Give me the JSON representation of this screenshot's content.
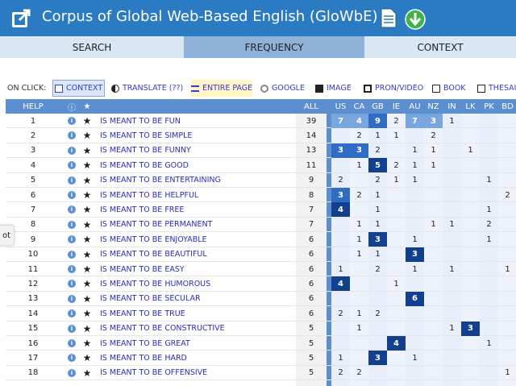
{
  "header": {
    "title": "Corpus of Global Web-Based English (GloWbE)"
  },
  "tabs": [
    {
      "label": "SEARCH",
      "active": false
    },
    {
      "label": "FREQUENCY",
      "active": true
    },
    {
      "label": "CONTEXT",
      "active": false
    }
  ],
  "onclick": {
    "label": "ON CLICK:",
    "options": [
      "CONTEXT",
      "TRANSLATE  (??)",
      "ENTIRE PAGE",
      "GOOGLE",
      "IMAGE",
      "PRON/VIDEO",
      "BOOK",
      "THESAURUS"
    ]
  },
  "side_tab": "ot",
  "table": {
    "headers": {
      "help": "HELP",
      "info": "ⓘ",
      "star": "★",
      "all": "ALL"
    },
    "countries": [
      "US",
      "CA",
      "GB",
      "IE",
      "AU",
      "NZ",
      "IN",
      "LK",
      "PK",
      "BD"
    ],
    "rows": [
      {
        "n": "1",
        "word": "IS MEANT TO BE FUN",
        "all": "39",
        "vals": [
          "7",
          "4",
          "9",
          "2",
          "7",
          "3",
          "1",
          "",
          "",
          ""
        ]
      },
      {
        "n": "2",
        "word": "IS MEANT TO BE SIMPLE",
        "all": "14",
        "vals": [
          "",
          "2",
          "1",
          "1",
          "",
          "2",
          "",
          "",
          "",
          ""
        ]
      },
      {
        "n": "3",
        "word": "IS MEANT TO BE FUNNY",
        "all": "13",
        "vals": [
          "3",
          "3",
          "2",
          "",
          "1",
          "1",
          "",
          "1",
          "",
          ""
        ]
      },
      {
        "n": "4",
        "word": "IS MEANT TO BE GOOD",
        "all": "11",
        "vals": [
          "",
          "1",
          "5",
          "2",
          "1",
          "1",
          "",
          "",
          "",
          ""
        ]
      },
      {
        "n": "5",
        "word": "IS MEANT TO BE ENTERTAINING",
        "all": "9",
        "vals": [
          "2",
          "",
          "2",
          "1",
          "1",
          "",
          "",
          "",
          "1",
          ""
        ]
      },
      {
        "n": "6",
        "word": "IS MEANT TO BE HELPFUL",
        "all": "8",
        "vals": [
          "3",
          "2",
          "1",
          "",
          "",
          "",
          "",
          "",
          "",
          "2"
        ]
      },
      {
        "n": "7",
        "word": "IS MEANT TO BE FREE",
        "all": "7",
        "vals": [
          "4",
          "",
          "1",
          "",
          "",
          "",
          "",
          "",
          "1",
          ""
        ]
      },
      {
        "n": "8",
        "word": "IS MEANT TO BE PERMANENT",
        "all": "7",
        "vals": [
          "",
          "1",
          "1",
          "",
          "",
          "1",
          "1",
          "",
          "2",
          ""
        ]
      },
      {
        "n": "9",
        "word": "IS MEANT TO BE ENJOYABLE",
        "all": "6",
        "vals": [
          "",
          "1",
          "3",
          "",
          "1",
          "",
          "",
          "",
          "1",
          ""
        ]
      },
      {
        "n": "10",
        "word": "IS MEANT TO BE BEAUTIFUL",
        "all": "6",
        "vals": [
          "",
          "1",
          "1",
          "",
          "3",
          "",
          "",
          "",
          "",
          ""
        ]
      },
      {
        "n": "11",
        "word": "IS MEANT TO BE EASY",
        "all": "6",
        "vals": [
          "1",
          "",
          "2",
          "",
          "1",
          "",
          "1",
          "",
          "",
          "1"
        ]
      },
      {
        "n": "12",
        "word": "IS MEANT TO BE HUMOROUS",
        "all": "6",
        "vals": [
          "4",
          "",
          "",
          "1",
          "",
          "",
          "",
          "",
          "",
          ""
        ]
      },
      {
        "n": "13",
        "word": "IS MEANT TO BE SECULAR",
        "all": "6",
        "vals": [
          "",
          "",
          "",
          "",
          "6",
          "",
          "",
          "",
          "",
          ""
        ]
      },
      {
        "n": "14",
        "word": "IS MEANT TO BE TRUE",
        "all": "6",
        "vals": [
          "2",
          "1",
          "2",
          "",
          "",
          "",
          "",
          "",
          "",
          ""
        ]
      },
      {
        "n": "15",
        "word": "IS MEANT TO BE CONSTRUCTIVE",
        "all": "5",
        "vals": [
          "",
          "1",
          "",
          "",
          "",
          "",
          "1",
          "3",
          "",
          ""
        ]
      },
      {
        "n": "16",
        "word": "IS MEANT TO BE GREAT",
        "all": "5",
        "vals": [
          "",
          "",
          "",
          "4",
          "",
          "",
          "",
          "",
          "1",
          ""
        ]
      },
      {
        "n": "17",
        "word": "IS MEANT TO BE HARD",
        "all": "5",
        "vals": [
          "1",
          "",
          "3",
          "",
          "1",
          "",
          "",
          "",
          "",
          ""
        ]
      },
      {
        "n": "18",
        "word": "IS MEANT TO BE OFFENSIVE",
        "all": "5",
        "vals": [
          "2",
          "2",
          "",
          "",
          "",
          "",
          "",
          "",
          "",
          "1"
        ]
      }
    ]
  },
  "colors": {
    "header_bg": "#2b7bc3",
    "table_header_bg": "#5c8fd0",
    "word_link": "#2b2bbf",
    "heat_light": "#7aa6e0",
    "heat_mid": "#2f6cc4",
    "heat_dark": "#123f8e"
  }
}
